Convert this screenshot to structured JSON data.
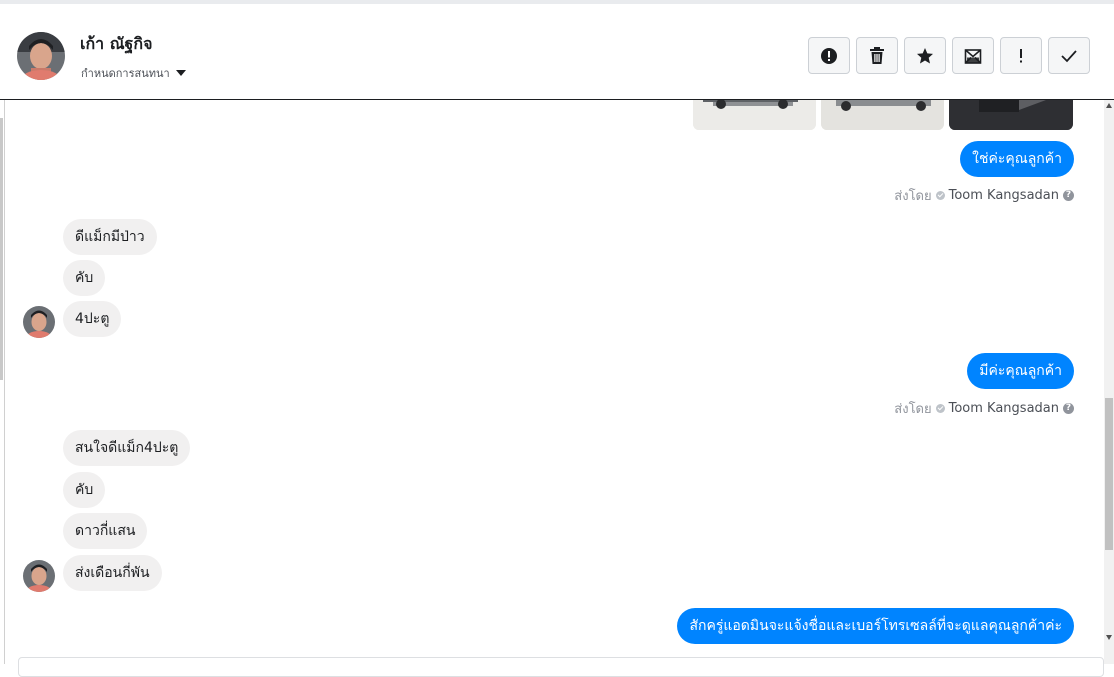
{
  "header": {
    "contact_name": "เก้า ณัฐกิจ",
    "conversation_menu_label": "กำหนดการสนทนา",
    "actions": [
      {
        "name": "mark-spam",
        "icon": "alert-circle-icon"
      },
      {
        "name": "delete",
        "icon": "trash-icon"
      },
      {
        "name": "star",
        "icon": "star-icon"
      },
      {
        "name": "mark-unread",
        "icon": "envelope-icon"
      },
      {
        "name": "important",
        "icon": "exclamation-icon"
      },
      {
        "name": "done",
        "icon": "check-icon"
      }
    ]
  },
  "thread": {
    "messages": [
      {
        "side": "outgoing",
        "text": "ใช่ค่ะคุณลูกค้า",
        "sent_by_label": "ส่งโดย",
        "sent_by_name": "Toom Kangsadan"
      },
      {
        "side": "incoming",
        "text": "ดีแม็กมีป่าว"
      },
      {
        "side": "incoming",
        "text": "คับ"
      },
      {
        "side": "incoming",
        "text": "4ปะตู"
      },
      {
        "side": "outgoing",
        "text": "มีค่ะคุณลูกค้า",
        "sent_by_label": "ส่งโดย",
        "sent_by_name": "Toom Kangsadan"
      },
      {
        "side": "incoming",
        "text": "สนใจดีแม็ก4ปะตู"
      },
      {
        "side": "incoming",
        "text": "คับ"
      },
      {
        "side": "incoming",
        "text": "ดาวกี่แสน"
      },
      {
        "side": "incoming",
        "text": "ส่งเดือนกี่พัน"
      },
      {
        "side": "outgoing",
        "text": "สักครู่แอดมินจะแจ้งชื่อและเบอร์โทรเซลล์ที่จะดูแลคุณลูกค้าค่ะ"
      }
    ]
  },
  "colors": {
    "outgoing_bubble": "#0084ff",
    "incoming_bubble": "#f1f0f0",
    "meta_text": "#90949c"
  }
}
